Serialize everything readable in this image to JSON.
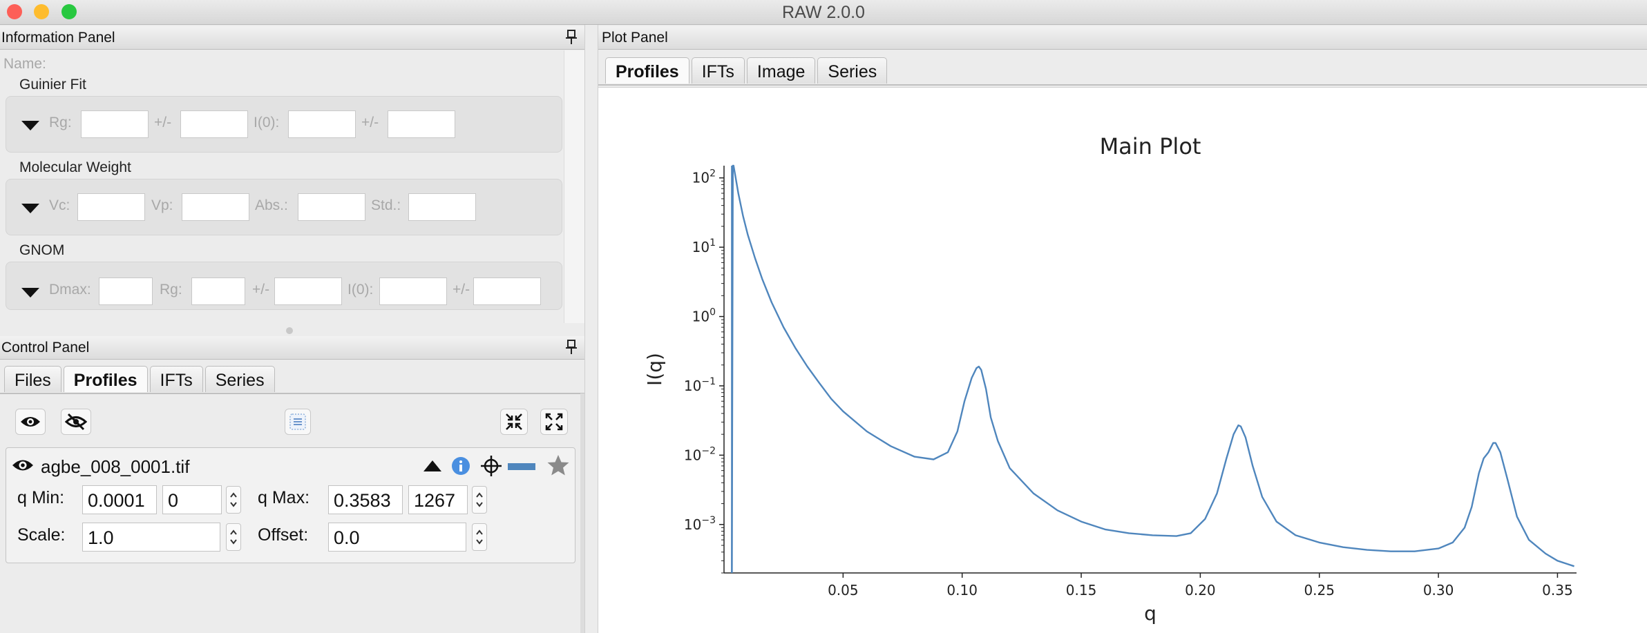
{
  "window": {
    "title": "RAW 2.0.0",
    "buttons": {
      "close_color": "#fd5f57",
      "minimize_color": "#febc2e",
      "zoom_color": "#28c840"
    }
  },
  "info_panel": {
    "title": "Information Panel",
    "name_label": "Name:",
    "guinier": {
      "title": "Guinier Fit",
      "rg_label": "Rg:",
      "pm1": "+/-",
      "i0_label": "I(0):",
      "pm2": "+/-"
    },
    "mw": {
      "title": "Molecular Weight",
      "vc_label": "Vc:",
      "vp_label": "Vp:",
      "abs_label": "Abs.:",
      "std_label": "Std.:"
    },
    "gnom": {
      "title": "GNOM",
      "dmax_label": "Dmax:",
      "rg_label": "Rg:",
      "pm1": "+/-",
      "i0_label": "I(0):",
      "pm2": "+/-"
    }
  },
  "control_panel": {
    "title": "Control Panel",
    "tabs": [
      "Files",
      "Profiles",
      "IFTs",
      "Series"
    ],
    "active_tab": "Profiles",
    "profile": {
      "filename": "agbe_008_0001.tif",
      "line_color": "#4f86bd",
      "qmin_label": "q Min:",
      "qmin_value": "0.0001",
      "qmin_index": "0",
      "qmax_label": "q Max:",
      "qmax_value": "0.3583",
      "qmax_index": "1267",
      "scale_label": "Scale:",
      "scale_value": "1.0",
      "offset_label": "Offset:",
      "offset_value": "0.0"
    }
  },
  "plot_panel": {
    "title": "Plot Panel",
    "tabs": [
      "Profiles",
      "IFTs",
      "Image",
      "Series"
    ],
    "active_tab": "Profiles"
  },
  "chart_data": {
    "type": "line",
    "title": "Main Plot",
    "xlabel": "q",
    "ylabel": "I(q)",
    "yscale": "log",
    "xlim": [
      0.0,
      0.358
    ],
    "ylim": [
      0.0002,
      150
    ],
    "xticks": [
      0.05,
      0.1,
      0.15,
      0.2,
      0.25,
      0.3,
      0.35
    ],
    "xtick_labels": [
      "0.05",
      "0.10",
      "0.15",
      "0.20",
      "0.25",
      "0.30",
      "0.35"
    ],
    "yticks": [
      100,
      10,
      1,
      0.1,
      0.01,
      0.001
    ],
    "ytick_labels": [
      {
        "base": "10",
        "exp": "2"
      },
      {
        "base": "10",
        "exp": "1"
      },
      {
        "base": "10",
        "exp": "0"
      },
      {
        "base": "10",
        "exp": "−1"
      },
      {
        "base": "10",
        "exp": "−2"
      },
      {
        "base": "10",
        "exp": "−3"
      }
    ],
    "grid": false,
    "line_color": "#4f86bd",
    "series": [
      {
        "x": [
          0.0033,
          0.0037,
          0.004,
          0.0045,
          0.006,
          0.008,
          0.01,
          0.013,
          0.016,
          0.02,
          0.025,
          0.03,
          0.035,
          0.04,
          0.045,
          0.05,
          0.06,
          0.07,
          0.08,
          0.088,
          0.094,
          0.098,
          0.101,
          0.104,
          0.106,
          0.107,
          0.108,
          0.11,
          0.112,
          0.115,
          0.12,
          0.13,
          0.14,
          0.15,
          0.16,
          0.17,
          0.18,
          0.19,
          0.196,
          0.202,
          0.207,
          0.211,
          0.214,
          0.216,
          0.217,
          0.219,
          0.222,
          0.226,
          0.232,
          0.24,
          0.25,
          0.26,
          0.27,
          0.28,
          0.29,
          0.3,
          0.306,
          0.311,
          0.314,
          0.317,
          0.319,
          0.321,
          0.323,
          0.324,
          0.326,
          0.329,
          0.333,
          0.338,
          0.345,
          0.35,
          0.354,
          0.357
        ],
        "y": [
          0.0002,
          150,
          150,
          120,
          60,
          28,
          15,
          7,
          3.5,
          1.6,
          0.7,
          0.35,
          0.19,
          0.11,
          0.065,
          0.043,
          0.022,
          0.0135,
          0.0095,
          0.0087,
          0.011,
          0.022,
          0.06,
          0.13,
          0.18,
          0.19,
          0.17,
          0.09,
          0.035,
          0.016,
          0.0065,
          0.0028,
          0.0016,
          0.0011,
          0.00085,
          0.00075,
          0.0007,
          0.00068,
          0.00075,
          0.0012,
          0.0028,
          0.009,
          0.02,
          0.027,
          0.026,
          0.018,
          0.007,
          0.0025,
          0.0011,
          0.0007,
          0.00055,
          0.00047,
          0.00043,
          0.00041,
          0.00041,
          0.00045,
          0.00055,
          0.0009,
          0.0018,
          0.0055,
          0.009,
          0.011,
          0.015,
          0.015,
          0.011,
          0.0045,
          0.0013,
          0.0006,
          0.00038,
          0.0003,
          0.00027,
          0.00025
        ]
      }
    ]
  }
}
